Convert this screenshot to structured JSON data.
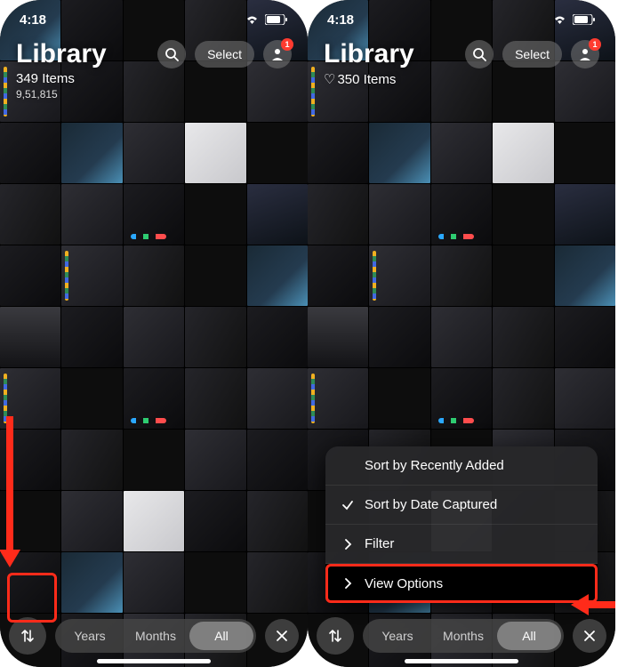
{
  "left": {
    "time": "4:18",
    "title": "Library",
    "item_count": "349 Items",
    "subcount": "9,51,815",
    "select_label": "Select",
    "badge": "1",
    "tabs": {
      "years": "Years",
      "months": "Months",
      "all": "All"
    },
    "active_tab": "all"
  },
  "right": {
    "time": "4:18",
    "title": "Library",
    "item_count": "350 Items",
    "select_label": "Select",
    "badge": "1",
    "tabs": {
      "years": "Years",
      "months": "Months",
      "all": "All"
    },
    "active_tab": "all",
    "menu": {
      "sort_recent": "Sort by Recently Added",
      "sort_date": "Sort by Date Captured",
      "filter": "Filter",
      "view_options": "View Options"
    }
  },
  "annotations": {
    "left_highlight": "sort-button",
    "right_highlight": "view-options-menu-item"
  }
}
